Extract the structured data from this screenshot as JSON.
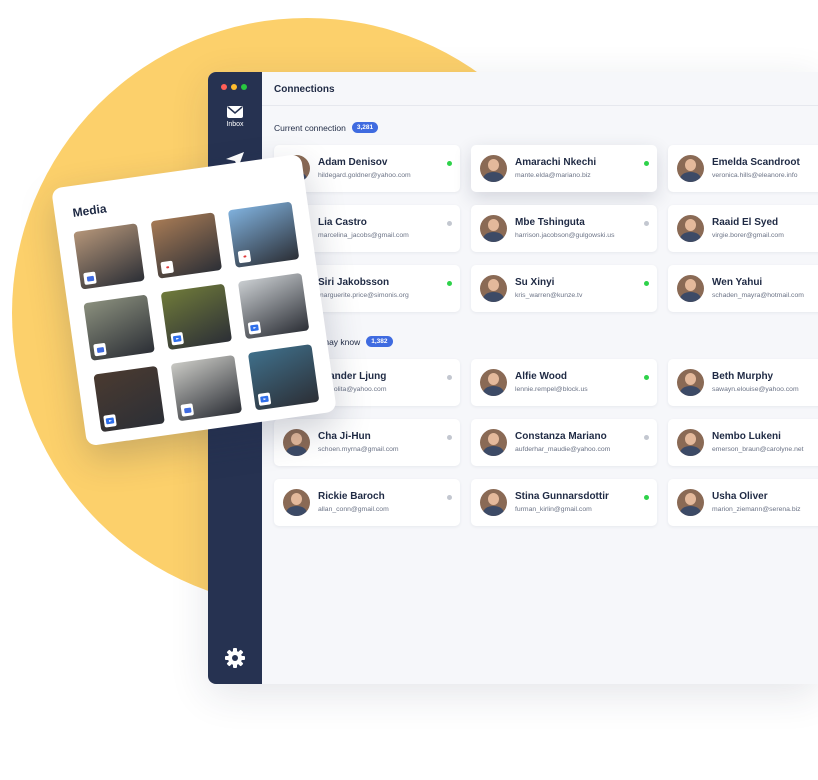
{
  "app": {
    "header_title": "Connections",
    "nav": {
      "inbox_label": "Inbox"
    }
  },
  "current_connection": {
    "title": "Current connection",
    "count": "3,281",
    "cards": [
      {
        "name": "Adam Denisov",
        "email": "hildegard.goldner@yahoo.com",
        "status": "online"
      },
      {
        "name": "Amarachi Nkechi",
        "email": "mante.elda@mariano.biz",
        "status": "online"
      },
      {
        "name": "Emelda Scandroot",
        "email": "veronica.hills@eleanore.info",
        "status": "none"
      },
      {
        "name": "Lia Castro",
        "email": "marcelina_jacobs@gmail.com",
        "status": "offline"
      },
      {
        "name": "Mbe Tshinguta",
        "email": "harrison.jacobson@gulgowski.us",
        "status": "offline"
      },
      {
        "name": "Raaid El Syed",
        "email": "virgie.borer@gmail.com",
        "status": "none"
      },
      {
        "name": "Siri Jakobsson",
        "email": "marguerite.price@simonis.org",
        "status": "online"
      },
      {
        "name": "Su Xinyi",
        "email": "kris_warren@kunze.tv",
        "status": "online"
      },
      {
        "name": "Wen Yahui",
        "email": "schaden_mayra@hotmail.com",
        "status": "none"
      }
    ]
  },
  "may_know": {
    "title": "may know",
    "count": "1,382",
    "cards": [
      {
        "name": "exander Ljung",
        "email": "cek_lolita@yahoo.com",
        "status": "offline"
      },
      {
        "name": "Alfie Wood",
        "email": "lennie.rempel@block.us",
        "status": "online"
      },
      {
        "name": "Beth Murphy",
        "email": "sawayn.elouise@yahoo.com",
        "status": "none"
      },
      {
        "name": "Cha Ji-Hun",
        "email": "schoen.myrna@gmail.com",
        "status": "offline"
      },
      {
        "name": "Constanza Mariano",
        "email": "aufderhar_maudie@yahoo.com",
        "status": "offline"
      },
      {
        "name": "Nembo Lukeni",
        "email": "emerson_braun@carolyne.net",
        "status": "none"
      },
      {
        "name": "Rickie Baroch",
        "email": "allan_conn@gmail.com",
        "status": "offline"
      },
      {
        "name": "Stina Gunnarsdottir",
        "email": "furman_kirlin@gmail.com",
        "status": "online"
      },
      {
        "name": "Usha Oliver",
        "email": "marion_ziemann@serena.biz",
        "status": "none"
      }
    ]
  },
  "media": {
    "title": "Media",
    "items": [
      {
        "subject": "white dog",
        "type": "image",
        "color": "#b39478"
      },
      {
        "subject": "city skyline",
        "type": "pdf",
        "color": "#a67a55"
      },
      {
        "subject": "wind turbine",
        "type": "pdf",
        "color": "#7fb0dc"
      },
      {
        "subject": "mountain valley",
        "type": "image",
        "color": "#8a8f7d"
      },
      {
        "subject": "food plate",
        "type": "video",
        "color": "#6f7a3a"
      },
      {
        "subject": "person in red",
        "type": "video",
        "color": "#c9cdd0"
      },
      {
        "subject": "cafe interior",
        "type": "video",
        "color": "#4a3a30"
      },
      {
        "subject": "laptop desk",
        "type": "image",
        "color": "#c9c9c4"
      },
      {
        "subject": "palm beach",
        "type": "video",
        "color": "#3f6f8a"
      }
    ]
  },
  "colors": {
    "sidebar": "#263251",
    "accent": "#3f6be0",
    "background_circle": "#fcd06b",
    "online": "#2ed24a",
    "offline": "#c3c7d0"
  }
}
